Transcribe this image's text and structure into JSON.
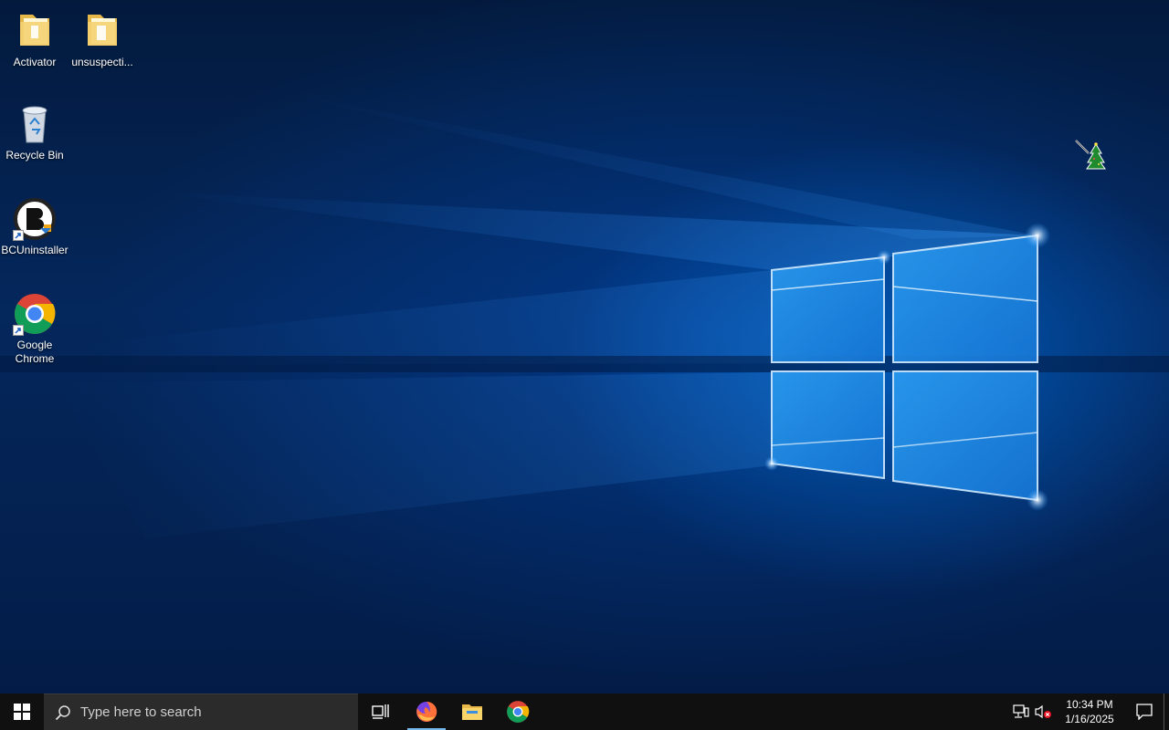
{
  "desktop": {
    "icons": [
      {
        "label": "Activator",
        "icon": "folder-icon"
      },
      {
        "label": "unsuspecti...",
        "icon": "folder-icon"
      },
      {
        "label": "Recycle Bin",
        "icon": "recycle-bin-icon"
      },
      {
        "label": "BCUninstaller",
        "icon": "bcuninstaller-icon",
        "shortcut": true
      },
      {
        "label": "Google Chrome",
        "icon": "chrome-icon",
        "shortcut": true
      }
    ]
  },
  "taskbar": {
    "search_placeholder": "Type here to search",
    "pinned": [
      "task-view-icon",
      "firefox-icon",
      "file-explorer-icon",
      "chrome-icon"
    ],
    "active_app": "firefox",
    "clock": {
      "time": "10:34 PM",
      "date": "1/16/2025"
    },
    "tray_icons": [
      "network-icon",
      "volume-muted-icon"
    ]
  },
  "colors": {
    "accent": "#0078d7",
    "taskbar_bg": "#101010",
    "search_bg": "#2b2b2b"
  }
}
